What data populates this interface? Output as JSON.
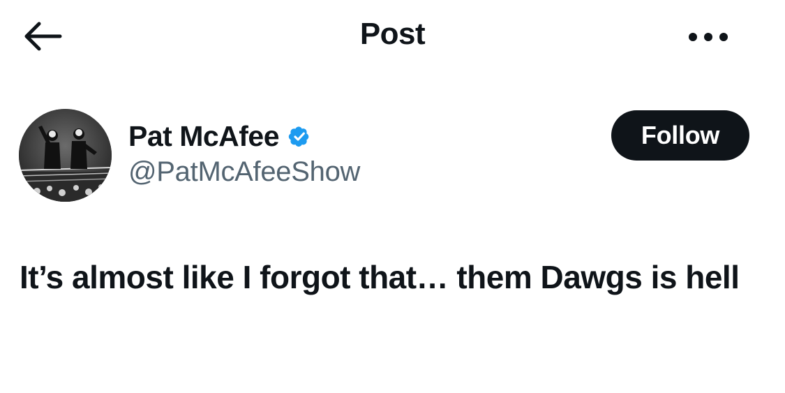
{
  "header": {
    "title": "Post",
    "back_icon": "arrow-left-icon",
    "more_icon": "more-horizontal-icon"
  },
  "author": {
    "display_name": "Pat McAfee",
    "handle": "@PatMcAfeeShow",
    "verified": true,
    "verified_color": "#1d9bf0"
  },
  "actions": {
    "follow_label": "Follow"
  },
  "post": {
    "text": "It’s almost like I forgot that… them Dawgs is hell"
  },
  "colors": {
    "text_primary": "#0f1419",
    "text_secondary": "#536471",
    "button_bg": "#0f1419",
    "button_text": "#ffffff"
  }
}
